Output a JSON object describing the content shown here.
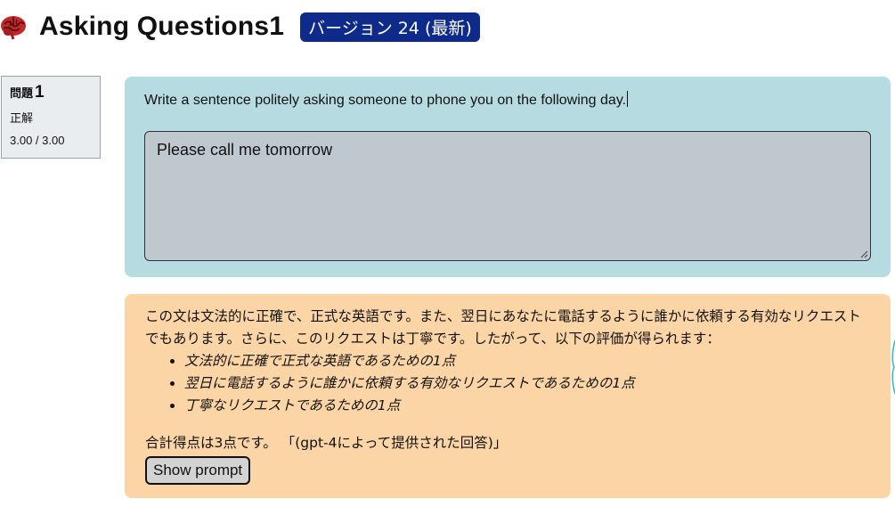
{
  "header": {
    "icon": "brain-icon",
    "title": "Asking Questions1",
    "version_badge": "バージョン 24 (最新)"
  },
  "question_card": {
    "label": "問題",
    "number": "1",
    "status": "正解",
    "score": "3.00 / 3.00"
  },
  "prompt": {
    "text": "Write a sentence politely asking someone to phone you on the following day.",
    "answer_value": "Please call me tomorrow"
  },
  "feedback": {
    "intro": "この文は文法的に正確で、正式な英語です。また、翌日にあなたに電話するように誰かに依頼する有効なリクエストでもあります。さらに、このリクエストは丁寧です。したがって、以下の評価が得られます：",
    "points": [
      "文法的に正確で正式な英語であるための1点",
      "翌日に電話するように誰かに依頼する有効なリクエストであるための1点",
      "丁寧なリクエストであるための1点"
    ],
    "total": "合計得点は3点です。 「(gpt-4によって提供された回答)」",
    "show_prompt_label": "Show prompt"
  },
  "colors": {
    "badge": "#0e2a8a",
    "prompt_panel": "#b6dce2",
    "answer_box": "#bfc8ce",
    "feedback_panel": "#fbd5a5",
    "brain": "#c0282a"
  }
}
